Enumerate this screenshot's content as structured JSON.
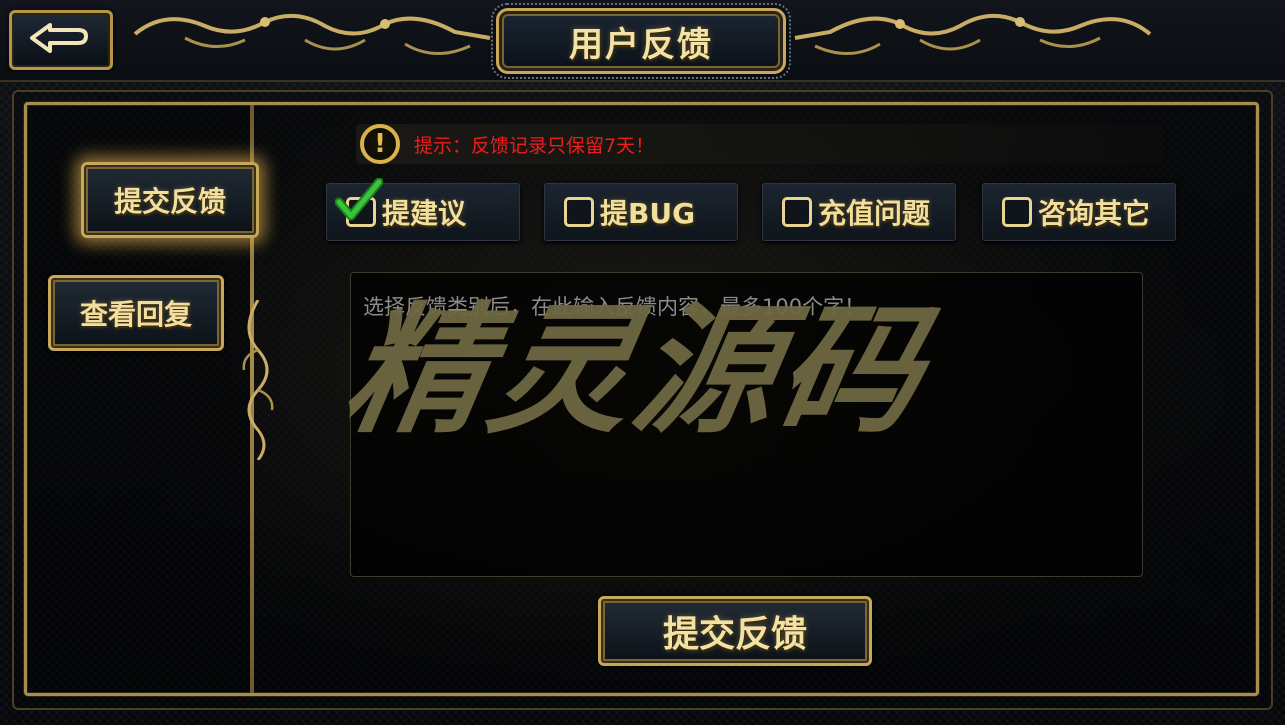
{
  "header": {
    "title": "用户反馈",
    "back_icon": "return-arrow-icon"
  },
  "sidebar": {
    "items": [
      {
        "label": "提交反馈",
        "active": true
      },
      {
        "label": "查看回复",
        "active": false
      }
    ]
  },
  "notice": {
    "icon": "warning-icon",
    "text": "提示：反馈记录只保留7天！"
  },
  "categories": [
    {
      "label": "提建议",
      "checked": true
    },
    {
      "label": "提BUG",
      "checked": false
    },
    {
      "label": "充值问题",
      "checked": false
    },
    {
      "label": "咨询其它",
      "checked": false
    }
  ],
  "feedback": {
    "placeholder": "选择反馈类别后，在此输入反馈内容，最多100个字！",
    "value": ""
  },
  "watermark": "精灵源码",
  "submit": {
    "label": "提交反馈"
  },
  "colors": {
    "gold": "#c7a75a",
    "gold_text": "#f2dfa0",
    "notice_red": "#ee1d1d",
    "check_green": "#2aa52a"
  }
}
